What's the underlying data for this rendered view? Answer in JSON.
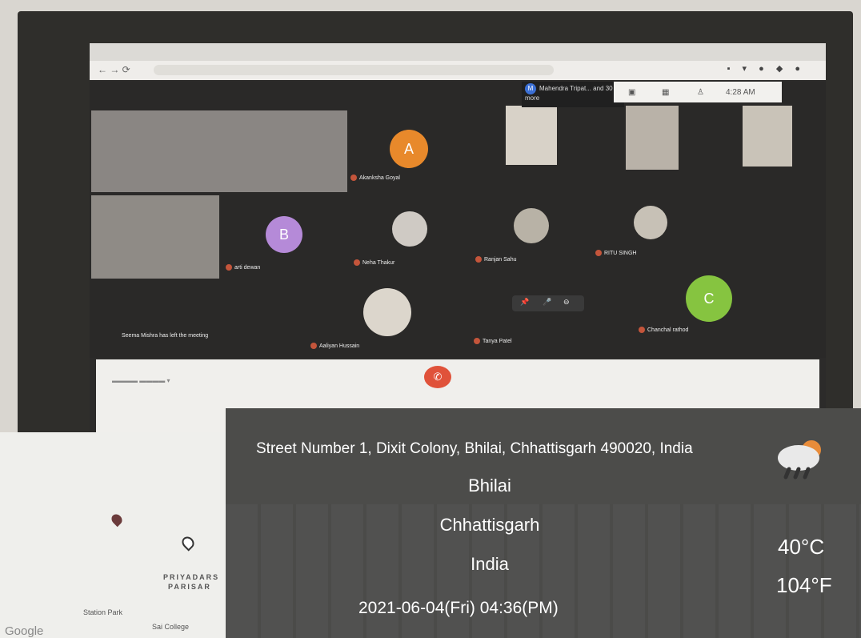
{
  "meet": {
    "notification": {
      "avatar": "M",
      "text": "Mahendra Tripat... and 30 more"
    },
    "clock": "4:28 AM",
    "left_message": "Seema Mishra has left the meeting",
    "participants": [
      {
        "name": "Akanksha Goyal",
        "initial": "A",
        "color": "#e8892b"
      },
      {
        "name": "arti dewan",
        "initial": "B",
        "color": "#b58ad8"
      },
      {
        "name": "Neha Thakur"
      },
      {
        "name": "Ranjan Sahu"
      },
      {
        "name": "RITU SINGH"
      },
      {
        "name": "Aaliyan Hussain"
      },
      {
        "name": "Tanya Patel"
      },
      {
        "name": "Chanchal rathod",
        "initial": "C",
        "color": "#86c440"
      }
    ]
  },
  "gps": {
    "address": "Street Number 1, Dixit Colony, Bhilai, Chhattisgarh 490020, India",
    "city": "Bhilai",
    "state": "Chhattisgarh",
    "country": "India",
    "datetime": "2021-06-04(Fri)   04:36(PM)",
    "temp_c": "40°C",
    "temp_f": "104°F"
  },
  "map": {
    "place1": "PRIYADARS",
    "place2": "PARISAR",
    "place3": "Station Park",
    "place4": "Sai College",
    "brand": "Google"
  }
}
